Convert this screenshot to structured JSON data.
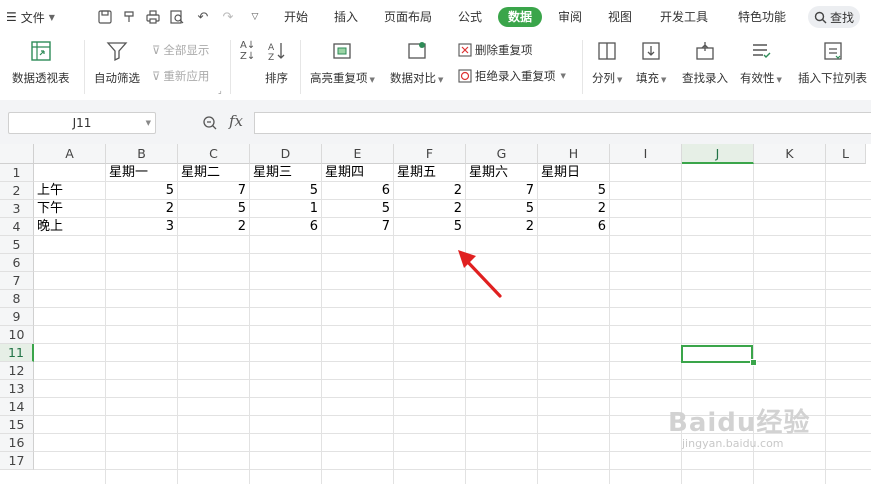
{
  "menubar": {
    "file_label": "文件",
    "tabs": [
      "开始",
      "插入",
      "页面布局",
      "公式",
      "数据",
      "审阅",
      "视图",
      "开发工具",
      "特色功能"
    ],
    "active_tab": "数据",
    "search_label": "查找"
  },
  "ribbon": {
    "pivot_table": "数据透视表",
    "auto_filter": "自动筛选",
    "show_all": "全部显示",
    "reapply": "重新应用",
    "sort": "排序",
    "highlight_dup": "高亮重复项",
    "data_compare": "数据对比",
    "delete_dup": "删除重复项",
    "reject_dup": "拒绝录入重复项",
    "split_col": "分列",
    "fill": "填充",
    "find_entry": "查找录入",
    "validity": "有效性",
    "insert_dropdown": "插入下拉列表"
  },
  "formula_bar": {
    "name_box": "J11",
    "fx_label": "fx",
    "formula_value": ""
  },
  "columns": [
    "A",
    "B",
    "C",
    "D",
    "E",
    "F",
    "G",
    "H",
    "I",
    "J",
    "K",
    "L"
  ],
  "rows": [
    "1",
    "2",
    "3",
    "4",
    "5",
    "6",
    "7",
    "8",
    "9",
    "10",
    "11",
    "12",
    "13",
    "14",
    "15",
    "16",
    "17"
  ],
  "selected_column": "J",
  "selected_row": "11",
  "sheet": {
    "header_row": [
      "星期一",
      "星期二",
      "星期三",
      "星期四",
      "星期五",
      "星期六",
      "星期日"
    ],
    "data_rows": [
      {
        "label": "上午",
        "values": [
          "5",
          "7",
          "5",
          "6",
          "2",
          "7",
          "5"
        ]
      },
      {
        "label": "下午",
        "values": [
          "2",
          "5",
          "1",
          "5",
          "2",
          "5",
          "2"
        ]
      },
      {
        "label": "晚上",
        "values": [
          "3",
          "2",
          "6",
          "7",
          "5",
          "2",
          "6"
        ]
      }
    ]
  },
  "watermark": {
    "brand": "Baidu经验",
    "url": "jingyan.baidu.com"
  },
  "colors": {
    "accent": "#3aa54a",
    "annotation_arrow": "#e02020"
  }
}
